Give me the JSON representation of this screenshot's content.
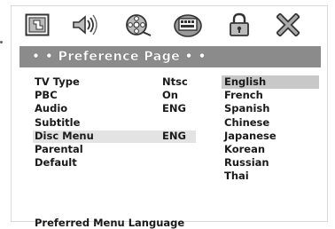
{
  "icons": [
    {
      "name": "general-setup-icon",
      "selected": false
    },
    {
      "name": "audio-speaker-icon",
      "selected": false
    },
    {
      "name": "video-reel-icon",
      "selected": false
    },
    {
      "name": "preference-settings-icon",
      "selected": true
    },
    {
      "name": "password-lock-icon",
      "selected": false
    },
    {
      "name": "exit-icon",
      "selected": false
    }
  ],
  "page": {
    "title": "• • Preference Page • •"
  },
  "menu": {
    "rows": [
      {
        "label": "TV Type",
        "value": "Ntsc",
        "selected": false
      },
      {
        "label": "PBC",
        "value": "On",
        "selected": false
      },
      {
        "label": "Audio",
        "value": "ENG",
        "selected": false
      },
      {
        "label": "Subtitle",
        "value": "",
        "selected": false
      },
      {
        "label": "Disc Menu",
        "value": "ENG",
        "selected": true
      },
      {
        "label": "Parental",
        "value": "",
        "selected": false
      },
      {
        "label": "Default",
        "value": "",
        "selected": false
      }
    ]
  },
  "options": [
    {
      "label": "English",
      "highlight": true
    },
    {
      "label": "French",
      "highlight": false
    },
    {
      "label": "Spanish",
      "highlight": false
    },
    {
      "label": "Chinese",
      "highlight": false
    },
    {
      "label": "Japanese",
      "highlight": false
    },
    {
      "label": "Korean",
      "highlight": false
    },
    {
      "label": "Russian",
      "highlight": false
    },
    {
      "label": "Thai",
      "highlight": false
    }
  ],
  "footer": {
    "hint": "Preferred Menu Language"
  },
  "colors": {
    "title_bar": "#8b8b8b",
    "option_highlight": "#c8c8c8",
    "selected_row": "#e3e3e3",
    "text": "#1a1a1a"
  }
}
